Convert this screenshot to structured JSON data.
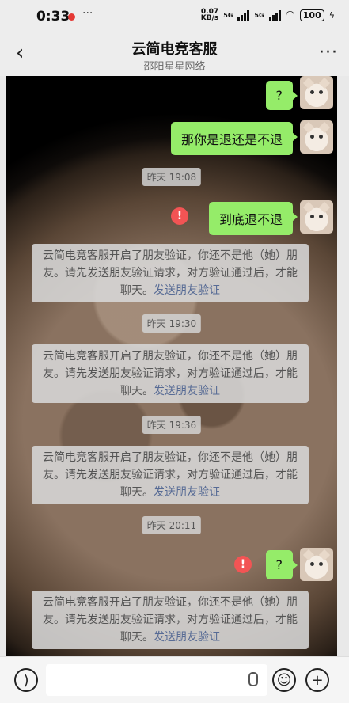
{
  "status": {
    "time": "0:33",
    "speed_value": "0.07",
    "speed_unit": "KB/s",
    "net1": "5G",
    "net2": "5G",
    "battery": "100"
  },
  "header": {
    "title": "云简电竞客服",
    "subtitle": "邵阳星星网络"
  },
  "messages": {
    "m1": "?",
    "m2": "那你是退还是不退",
    "t1": "昨天 19:08",
    "m3": "到底退不退",
    "sys_text": "云简电竞客服开启了朋友验证，你还不是他（她）朋友。请先发送朋友验证请求，对方验证通过后，才能聊天。",
    "sys_link": "发送朋友验证",
    "t2": "昨天 19:30",
    "t3": "昨天 19:36",
    "t4": "昨天 20:11",
    "m4": "?"
  },
  "colors": {
    "bubble_green": "#95ec69",
    "error_red": "#f25454",
    "link_blue": "#576b95"
  }
}
